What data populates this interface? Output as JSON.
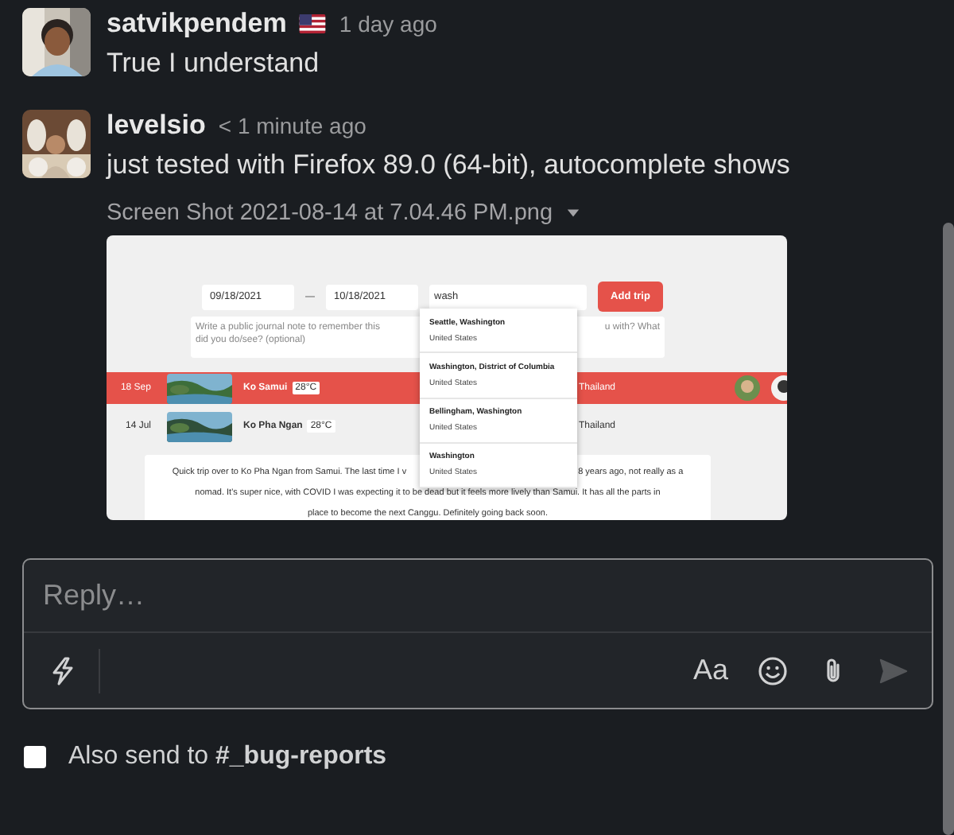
{
  "messages": [
    {
      "author": "satvikpendem",
      "flag": true,
      "time": "1 day ago",
      "text": "True I understand"
    },
    {
      "author": "levelsio",
      "time": "< 1 minute ago",
      "text": "just tested with Firefox 89.0 (64-bit), autocomplete shows",
      "attachment": {
        "filename": "Screen Shot 2021-08-14 at 7.04.46 PM.png",
        "screenshot": {
          "date_from": "09/18/2021",
          "date_to": "10/18/2021",
          "place_value": "wash",
          "add_button": "Add trip",
          "note_placeholder_parts": [
            "Write a public journal note to remember this",
            "u with? What",
            "did you do/see? (optional)"
          ],
          "suggestions": [
            {
              "name": "Seattle, Washington",
              "country": "United States"
            },
            {
              "name": "Washington, District of Columbia",
              "country": "United States"
            },
            {
              "name": "Bellingham, Washington",
              "country": "United States"
            },
            {
              "name": "Washington",
              "country": "United States"
            }
          ],
          "trips": [
            {
              "date": "18 Sep",
              "place": "Ko Samui",
              "temp": "28°C",
              "country": "Thailand",
              "selected": true
            },
            {
              "date": "14 Jul",
              "place": "Ko Pha Ngan",
              "temp": "28°C",
              "country": "Thailand",
              "selected": false
            }
          ],
          "journal_lines": [
            [
              "Quick trip over to Ko Pha Ngan from Samui. The last time I v",
              "8 years ago, not really as a"
            ],
            [
              "nomad. It's super nice, with COVID I was expecting it to be dead but it feels more lively than Samui. It has all the parts in"
            ],
            [
              "place to become the next Canggu. Definitely going back soon."
            ]
          ]
        }
      }
    }
  ],
  "composer": {
    "placeholder": "Reply…",
    "format_label": "Aa"
  },
  "also_send": {
    "checked": false,
    "label": "Also send to **#_bug-reports**"
  }
}
